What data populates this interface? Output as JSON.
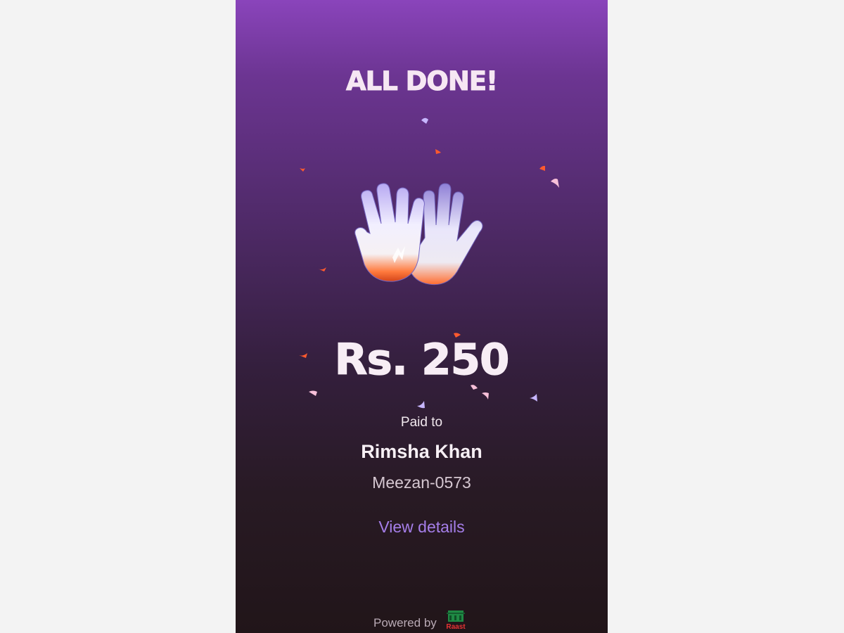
{
  "screen": {
    "title": "ALL DONE!",
    "hero_icon": "clapping-hands-icon",
    "amount": "Rs. 250",
    "paid_to_label": "Paid to",
    "payee_name": "Rimsha Khan",
    "payee_account": "Meezan-0573",
    "view_details_label": "View details"
  },
  "footer": {
    "powered_by_label": "Powered by",
    "brand_logo_text": "Raast",
    "brand_logo_icon": "raast-logo"
  },
  "colors": {
    "gradient_top": "#8a44bb",
    "gradient_bottom": "#211519",
    "link": "#a57ee9",
    "text": "#f7f0f5",
    "confetti_orange": "#ff5a2e",
    "confetti_pink": "#f7c0d9",
    "confetti_lilac": "#c7b6ff"
  }
}
